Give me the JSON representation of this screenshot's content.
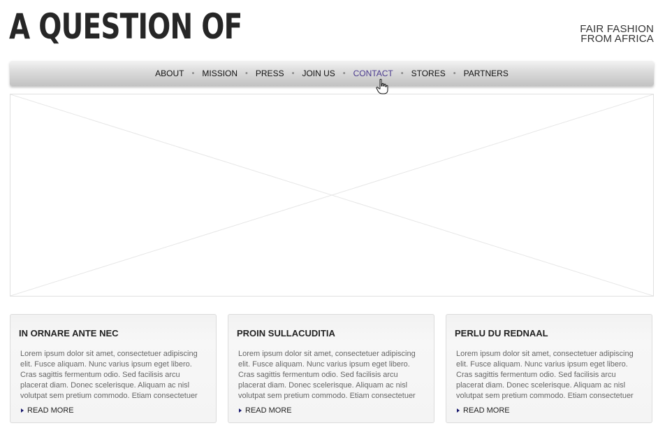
{
  "header": {
    "logo": "A QUESTION OF",
    "tagline_line1": "FAIR FASHION",
    "tagline_line2": "FROM AFRICA"
  },
  "nav": {
    "items": [
      {
        "label": "ABOUT",
        "active": false
      },
      {
        "label": "MISSION",
        "active": false
      },
      {
        "label": "PRESS",
        "active": false
      },
      {
        "label": "JOIN US",
        "active": false
      },
      {
        "label": "CONTACT",
        "active": true
      },
      {
        "label": "STORES",
        "active": false
      },
      {
        "label": "PARTNERS",
        "active": false
      }
    ],
    "separator": "•",
    "active_color": "#4a3a8e"
  },
  "hero": {
    "placeholder_icon": "image-placeholder-icon"
  },
  "cards": [
    {
      "title": "IN ORNARE ANTE NEC",
      "body": "Lorem ipsum dolor sit amet, consectetuer adipiscing elit. Fusce aliquam. Nunc varius ipsum eget libero. Cras sagittis fermentum odio. Sed facilisis arcu placerat diam. Donec scelerisque. Aliquam ac nisl volutpat sem pretium commodo. Etiam consectetuer",
      "read_more": "READ MORE"
    },
    {
      "title": "PROIN SULLACUDITIA",
      "body": "Lorem ipsum dolor sit amet, consectetuer adipiscing elit. Fusce aliquam. Nunc varius ipsum eget libero. Cras sagittis fermentum odio. Sed facilisis arcu placerat diam. Donec scelerisque. Aliquam ac nisl volutpat sem pretium commodo. Etiam consectetuer",
      "read_more": "READ MORE"
    },
    {
      "title": "PERLU DU REDNAAL",
      "body": "Lorem ipsum dolor sit amet, consectetuer adipiscing elit. Fusce aliquam. Nunc varius ipsum eget libero. Cras sagittis fermentum odio. Sed facilisis arcu placerat diam. Donec scelerisque. Aliquam ac nisl volutpat sem pretium commodo. Etiam consectetuer",
      "read_more": "READ MORE"
    }
  ]
}
